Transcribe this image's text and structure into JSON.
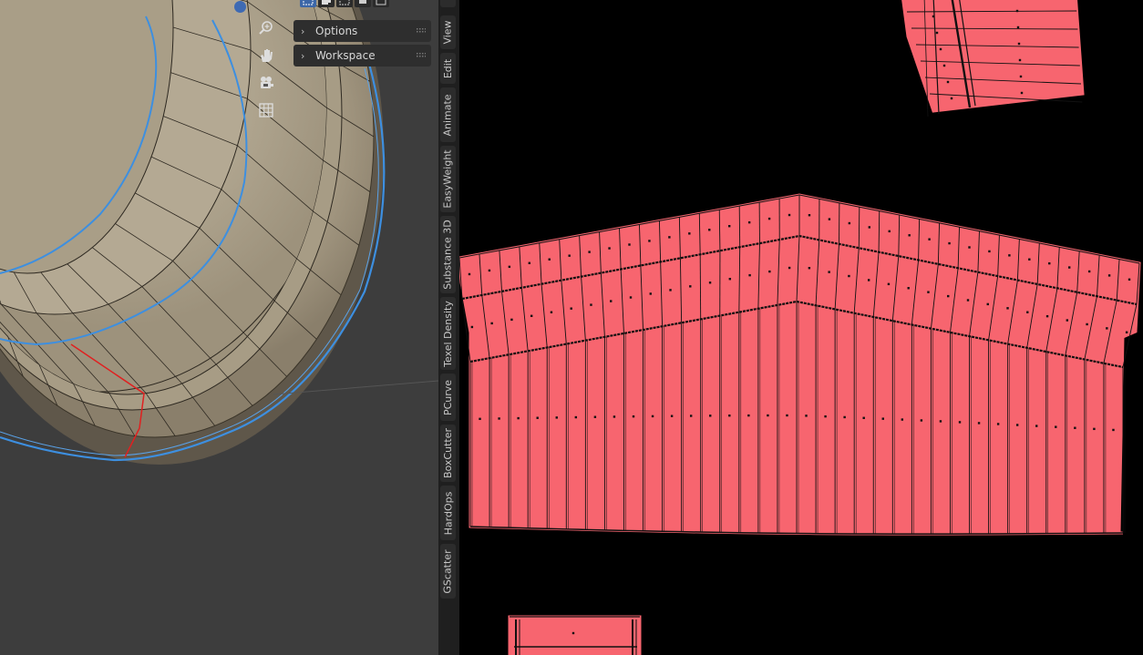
{
  "viewport": {
    "nav_tools": [
      {
        "name": "zoom",
        "icon": "zoom-icon"
      },
      {
        "name": "pan",
        "icon": "hand-icon"
      },
      {
        "name": "camera",
        "icon": "camera-icon"
      },
      {
        "name": "ortho",
        "icon": "grid-icon"
      }
    ],
    "panels": [
      {
        "label": "Options"
      },
      {
        "label": "Workspace"
      }
    ],
    "colors": {
      "background": "#3d3d3d",
      "mesh": "#a89c85",
      "selected_edge": "#3d8fe0",
      "seam": "#e02020"
    }
  },
  "sidebar_tabs": [
    "View",
    "Edit",
    "Animate",
    "EasyWeight",
    "Substance 3D",
    "Texel Density",
    "PCurve",
    "BoxCutter",
    "HardOps",
    "GScatter"
  ],
  "uv_editor": {
    "colors": {
      "background": "#000000",
      "island_fill": "#f7656f",
      "edge": "#111111"
    }
  }
}
